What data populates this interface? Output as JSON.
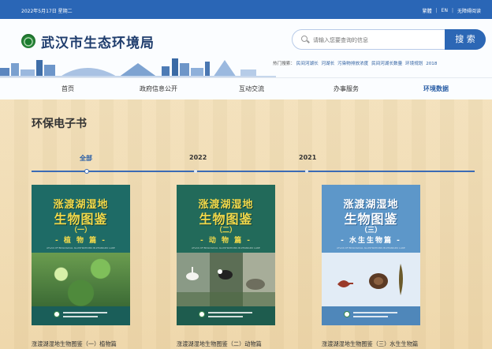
{
  "topbar": {
    "date": "2022年5月17日 星期二",
    "links": [
      "繁體",
      "EN",
      "无障碍阅读"
    ]
  },
  "header": {
    "site_title": "武汉市生态环境局",
    "search_placeholder": "请输入您要查询的信息",
    "search_button": "搜 索",
    "hot_label": "热门搜索：",
    "hot_keywords": [
      "民间河湖长",
      "河湖长",
      "污染物排放浓度",
      "民间河湖长数量",
      "环境规划",
      "2018"
    ]
  },
  "nav": {
    "items": [
      "首页",
      "政府信息公开",
      "互动交流",
      "办事服务",
      "环境数据"
    ],
    "active_index": 4
  },
  "main": {
    "title": "环保电子书",
    "tabs": [
      "全部",
      "2022",
      "2021"
    ],
    "active_tab": 0
  },
  "books": [
    {
      "cover_line1": "涨渡湖湿地",
      "cover_line2": "生物图鉴",
      "cover_line3": "（一）",
      "cover_line4": "- 植 物 篇 -",
      "cover_en": "ATLAS OF BIOLOGICAL ILLUSTRATIONS IN ZHANGDU LAKE",
      "caption": "涨渡湖湿地生物图鉴（一）植物篇"
    },
    {
      "cover_line1": "涨渡湖湿地",
      "cover_line2": "生物图鉴",
      "cover_line3": "（二）",
      "cover_line4": "- 动 物 篇 -",
      "cover_en": "ATLAS OF BIOLOGICAL ILLUSTRATIONS IN ZHANGDU LAKE",
      "caption": "涨渡湖湿地生物图鉴（二）动物篇"
    },
    {
      "cover_line1": "涨渡湖湿地",
      "cover_line2": "生物图鉴",
      "cover_line3": "（三）",
      "cover_line4": "- 水生生物篇 -",
      "cover_en": "ATLAS OF BIOLOGICAL ILLUSTRATIONS IN ZHANGDU LAKE",
      "caption": "涨渡湖湿地生物图鉴（三）水生生物篇"
    }
  ],
  "colors": {
    "brand_blue": "#2a66b6",
    "accent_blue": "#2b5fa6",
    "background": "#f1ddb4"
  }
}
